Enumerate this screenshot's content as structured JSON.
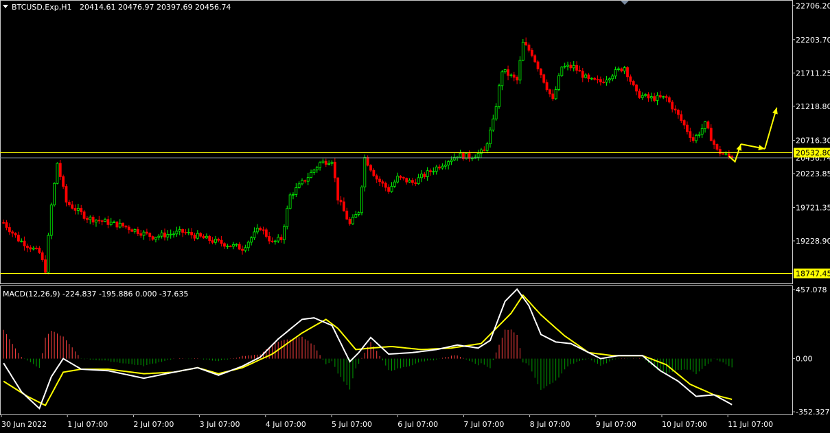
{
  "chart_data": [
    {
      "type": "candlestick",
      "header": {
        "symbol_label": "BTCUSD.Exp,H1",
        "ohlc_text": "20414.61 20476.97 20397.69 20456.74"
      },
      "colors": {
        "background": "#000000",
        "bull": "#00ff00",
        "bear": "#ff0000",
        "frame": "#c8c8c8",
        "level_line": "#ffff00",
        "level_label_bg": "#ffff00",
        "arrow": "#ffff00"
      },
      "grid": false,
      "ylim": [
        18600,
        22780
      ],
      "y_ticks": [
        "22706.20",
        "22203.70",
        "21711.25",
        "21218.80",
        "20716.30",
        "20223.85",
        "19721.35",
        "19228.90"
      ],
      "y_tick_values": [
        22706.2,
        22203.7,
        21711.25,
        21218.8,
        20716.3,
        20223.85,
        19721.35,
        19228.9
      ],
      "levels": [
        {
          "value": 20532.8,
          "label": "20532.80"
        },
        {
          "value": 18747.45,
          "label": "18747.45"
        }
      ],
      "current_price": 20456.74,
      "current_price_label": "20456.74",
      "x_labels": [
        "30 Jun 2022",
        "1 Jul 07:00",
        "2 Jul 07:00",
        "3 Jul 07:00",
        "4 Jul 07:00",
        "5 Jul 07:00",
        "6 Jul 07:00",
        "7 Jul 07:00",
        "8 Jul 07:00",
        "9 Jul 07:00",
        "10 Jul 07:00",
        "11 Jul 07:00"
      ],
      "bars_count": 264,
      "close_path": [
        [
          0,
          19500
        ],
        [
          5,
          19250
        ],
        [
          12,
          19050
        ],
        [
          14,
          18800
        ],
        [
          16,
          19750
        ],
        [
          18,
          20380
        ],
        [
          21,
          19800
        ],
        [
          28,
          19570
        ],
        [
          40,
          19450
        ],
        [
          50,
          19290
        ],
        [
          60,
          19360
        ],
        [
          70,
          19230
        ],
        [
          80,
          19120
        ],
        [
          86,
          19430
        ],
        [
          90,
          19200
        ],
        [
          93,
          19260
        ],
        [
          96,
          19900
        ],
        [
          102,
          20180
        ],
        [
          106,
          20380
        ],
        [
          110,
          20430
        ],
        [
          112,
          19860
        ],
        [
          116,
          19470
        ],
        [
          119,
          19670
        ],
        [
          121,
          20460
        ],
        [
          125,
          20150
        ],
        [
          129,
          19980
        ],
        [
          132,
          20160
        ],
        [
          137,
          20090
        ],
        [
          142,
          20230
        ],
        [
          147,
          20370
        ],
        [
          152,
          20500
        ],
        [
          156,
          20470
        ],
        [
          161,
          20550
        ],
        [
          164,
          20990
        ],
        [
          167,
          21750
        ],
        [
          172,
          21600
        ],
        [
          174,
          22150
        ],
        [
          177,
          22000
        ],
        [
          181,
          21600
        ],
        [
          184,
          21300
        ],
        [
          187,
          21800
        ],
        [
          191,
          21800
        ],
        [
          196,
          21600
        ],
        [
          200,
          21580
        ],
        [
          204,
          21700
        ],
        [
          208,
          21800
        ],
        [
          212,
          21400
        ],
        [
          216,
          21340
        ],
        [
          222,
          21340
        ],
        [
          226,
          21080
        ],
        [
          231,
          20720
        ],
        [
          235,
          20950
        ],
        [
          239,
          20560
        ],
        [
          244,
          20450
        ]
      ],
      "projection_arrows": [
        [
          [
            243,
            20480
          ],
          [
            245,
            20400
          ],
          [
            247,
            20660
          ]
        ],
        [
          [
            247,
            20660
          ],
          [
            255,
            20590
          ]
        ],
        [
          [
            255,
            20590
          ],
          [
            259,
            21200
          ]
        ]
      ]
    },
    {
      "type": "macd",
      "label": "MACD(12,26,9) -224.837 -195.886 0.000 -37.635",
      "ylim": [
        -370,
        480
      ],
      "y_ticks": [
        "457.078",
        "0.00",
        "-352.327"
      ],
      "y_tick_values": [
        457.078,
        0,
        -352.327
      ],
      "colors": {
        "macd_line": "#ffffff",
        "signal_line": "#ffff00",
        "hist_positive": "#ff4040",
        "hist_negative": "#00a000"
      },
      "macd_path": [
        [
          0,
          -30
        ],
        [
          6,
          -220
        ],
        [
          12,
          -330
        ],
        [
          16,
          -120
        ],
        [
          20,
          0
        ],
        [
          26,
          -70
        ],
        [
          35,
          -80
        ],
        [
          47,
          -130
        ],
        [
          57,
          -90
        ],
        [
          65,
          -60
        ],
        [
          72,
          -110
        ],
        [
          80,
          -50
        ],
        [
          86,
          10
        ],
        [
          92,
          130
        ],
        [
          100,
          260
        ],
        [
          104,
          270
        ],
        [
          110,
          220
        ],
        [
          116,
          -20
        ],
        [
          119,
          40
        ],
        [
          123,
          140
        ],
        [
          129,
          30
        ],
        [
          137,
          40
        ],
        [
          145,
          60
        ],
        [
          152,
          90
        ],
        [
          159,
          70
        ],
        [
          163,
          120
        ],
        [
          168,
          380
        ],
        [
          172,
          460
        ],
        [
          176,
          350
        ],
        [
          180,
          160
        ],
        [
          185,
          110
        ],
        [
          190,
          100
        ],
        [
          200,
          0
        ],
        [
          206,
          20
        ],
        [
          214,
          20
        ],
        [
          220,
          -80
        ],
        [
          226,
          -150
        ],
        [
          232,
          -250
        ],
        [
          238,
          -240
        ],
        [
          244,
          -305
        ]
      ],
      "signal_path": [
        [
          0,
          -150
        ],
        [
          8,
          -250
        ],
        [
          14,
          -310
        ],
        [
          20,
          -90
        ],
        [
          26,
          -70
        ],
        [
          35,
          -70
        ],
        [
          47,
          -100
        ],
        [
          57,
          -90
        ],
        [
          65,
          -60
        ],
        [
          72,
          -100
        ],
        [
          80,
          -60
        ],
        [
          90,
          30
        ],
        [
          100,
          170
        ],
        [
          108,
          260
        ],
        [
          112,
          200
        ],
        [
          118,
          60
        ],
        [
          123,
          70
        ],
        [
          130,
          80
        ],
        [
          140,
          60
        ],
        [
          150,
          70
        ],
        [
          160,
          100
        ],
        [
          170,
          300
        ],
        [
          174,
          420
        ],
        [
          180,
          290
        ],
        [
          188,
          150
        ],
        [
          196,
          40
        ],
        [
          204,
          20
        ],
        [
          214,
          20
        ],
        [
          222,
          -40
        ],
        [
          230,
          -170
        ],
        [
          238,
          -240
        ],
        [
          244,
          -270
        ]
      ]
    }
  ]
}
